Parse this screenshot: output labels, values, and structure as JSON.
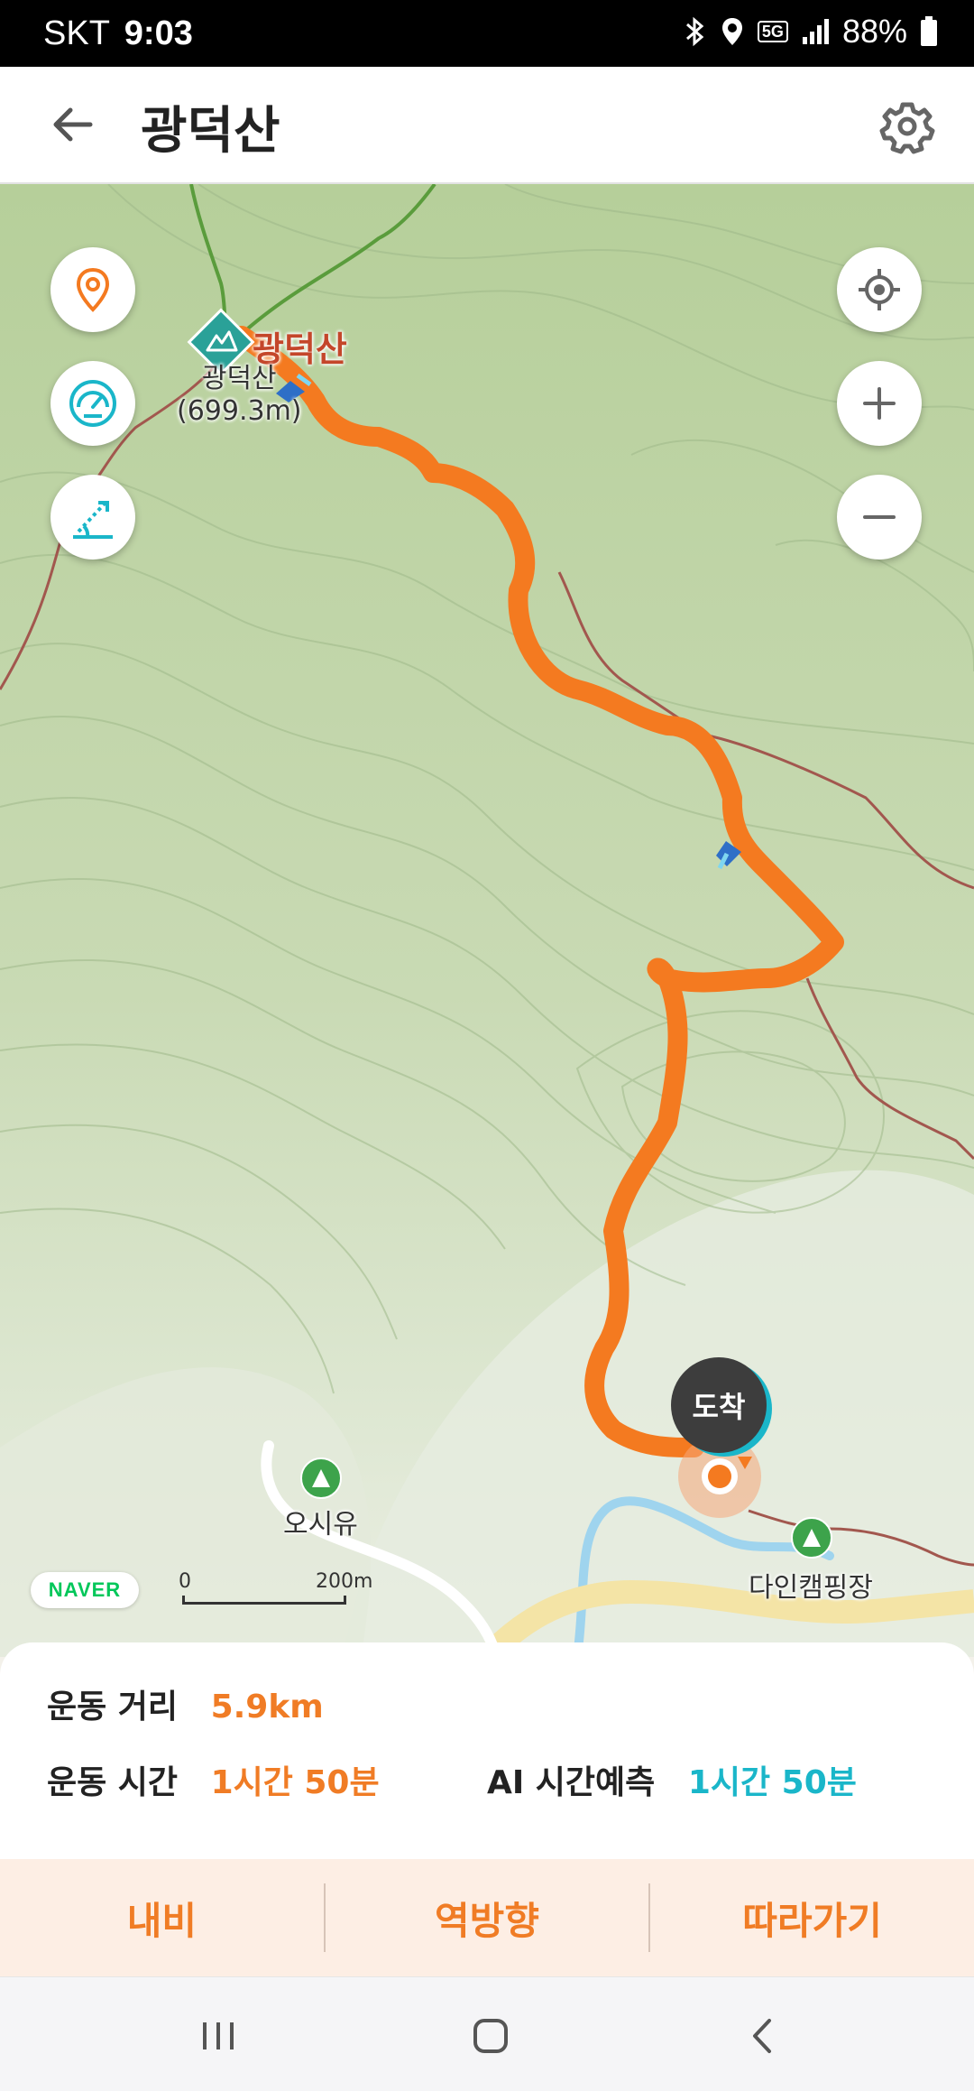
{
  "status_bar": {
    "carrier": "SKT",
    "time": "9:03",
    "network_badge": "5G",
    "battery": "88%",
    "icons": [
      "bluetooth-icon",
      "location-icon",
      "signal-icon",
      "battery-icon"
    ]
  },
  "header": {
    "title": "광덕산",
    "back_icon": "arrow-left-icon",
    "settings_icon": "gear-icon"
  },
  "map": {
    "peak_label": "광덕산",
    "peak_name": "광덕산",
    "peak_elevation": "(699.3m)",
    "campsites": [
      "오시유",
      "다인캠핑장"
    ],
    "arrival_label": "도착",
    "brand": "NAVER",
    "scale_start": "0",
    "scale_end": "200m",
    "route_color": "#f47a20",
    "left_controls": [
      "map-pin-icon",
      "speedometer-icon",
      "slope-icon"
    ],
    "right_controls": [
      "locate-icon",
      "zoom-in-icon",
      "zoom-out-icon"
    ]
  },
  "stats": {
    "distance_label": "운동 거리",
    "distance_value": "5.9km",
    "time_label": "운동 시간",
    "time_value": "1시간 50분",
    "ai_label": "AI 시간예측",
    "ai_value": "1시간 50분"
  },
  "actions": {
    "navigate": "내비",
    "reverse": "역방향",
    "follow": "따라가기"
  },
  "colors": {
    "accent_orange": "#f07c25",
    "accent_teal": "#1ab6c9",
    "action_bg": "#fdeee4"
  }
}
